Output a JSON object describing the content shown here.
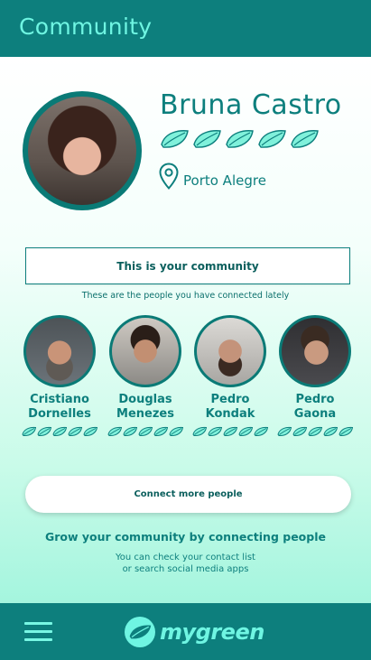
{
  "header": {
    "title": "Community"
  },
  "profile": {
    "name": "Bruna Castro",
    "leaf_rating": 5,
    "location": "Porto Alegre"
  },
  "community": {
    "title": "This is your community",
    "subtitle": "These are the people you have connected lately"
  },
  "connections": [
    {
      "first": "Cristiano",
      "last": "Dornelles",
      "leaf_rating": 5
    },
    {
      "first": "Douglas",
      "last": "Menezes",
      "leaf_rating": 5
    },
    {
      "first": "Pedro",
      "last": "Kondak",
      "leaf_rating": 5
    },
    {
      "first": "Pedro",
      "last": "Gaona",
      "leaf_rating": 5
    }
  ],
  "actions": {
    "connect_label": "Connect more people"
  },
  "grow": {
    "title": "Grow your community by connecting people",
    "line1": "You can check your contact list",
    "line2": "or search social media apps"
  },
  "footer": {
    "brand": "mygreen",
    "menu_icon": "hamburger-menu-icon"
  },
  "colors": {
    "primary": "#0d7f7d",
    "accent": "#6ff5e2",
    "leaf": "#78f0d9"
  }
}
